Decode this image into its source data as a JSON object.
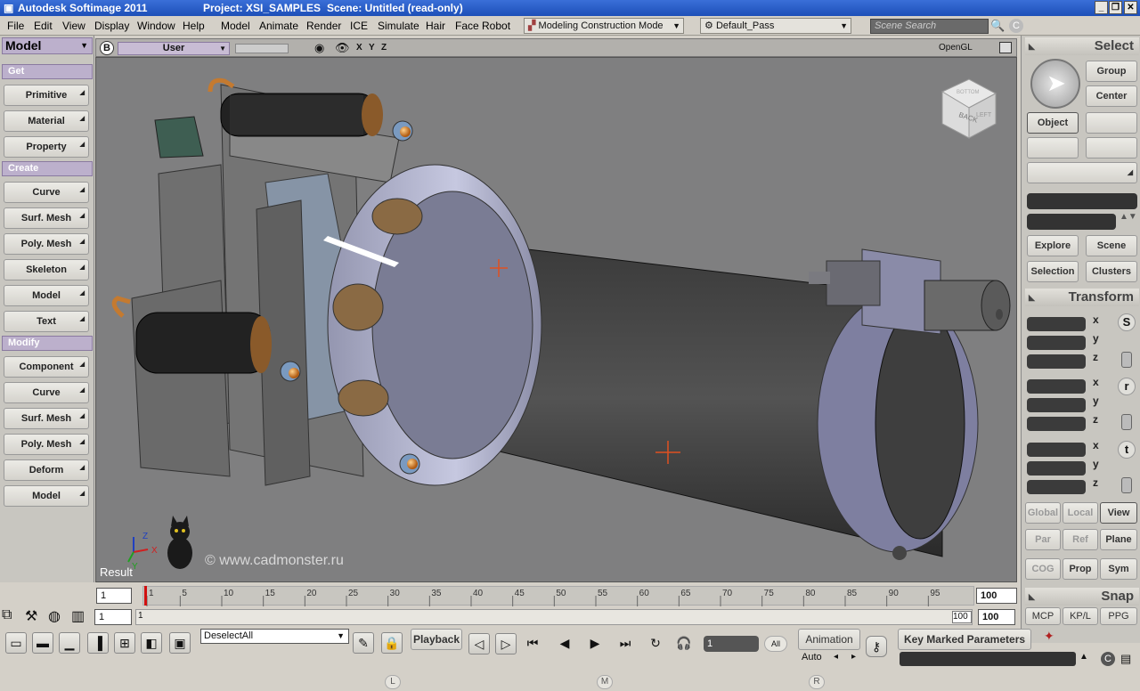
{
  "app": {
    "title": "Autodesk Softimage 2011",
    "project": "Project: XSI_SAMPLES",
    "scene": "Scene: Untitled (read-only)"
  },
  "menus": [
    "File",
    "Edit",
    "View",
    "Display",
    "Window",
    "Help",
    "Model",
    "Animate",
    "Render",
    "ICE",
    "Simulate",
    "Hair",
    "Face Robot"
  ],
  "mode_dropdown": "Modeling Construction Mode",
  "pass_dropdown": "Default_Pass",
  "search": {
    "placeholder": "Scene Search"
  },
  "left_panel": {
    "module": "Model",
    "get": {
      "header": "Get",
      "items": [
        "Primitive",
        "Material",
        "Property"
      ]
    },
    "create": {
      "header": "Create",
      "items": [
        "Curve",
        "Surf. Mesh",
        "Poly. Mesh",
        "Skeleton",
        "Model",
        "Text"
      ]
    },
    "modify": {
      "header": "Modify",
      "items": [
        "Component",
        "Curve",
        "Surf. Mesh",
        "Poly. Mesh",
        "Deform",
        "Model"
      ]
    }
  },
  "viewport": {
    "letter": "B",
    "camera": "User",
    "axes": [
      "X",
      "Y",
      "Z"
    ],
    "renderer": "OpenGL",
    "cube_labels": [
      "BACK",
      "LEFT",
      "BOTTOM"
    ],
    "axis_labels": [
      "Z",
      "X",
      "Y"
    ],
    "watermark": "© www.cadmonster.ru",
    "result": "Result"
  },
  "right_panel": {
    "select_header": "Select",
    "group": "Group",
    "center": "Center",
    "object": "Object",
    "explore": "Explore",
    "scene": "Scene",
    "selection": "Selection",
    "clusters": "Clusters",
    "transform_header": "Transform",
    "axes": [
      "x",
      "y",
      "z"
    ],
    "sections": [
      "S",
      "r",
      "t"
    ],
    "ref_buttons": [
      "Global",
      "Local",
      "View",
      "Par",
      "Ref",
      "Plane",
      "COG",
      "Prop",
      "Sym"
    ],
    "snap_header": "Snap",
    "tabs": [
      "MCP",
      "KP/L",
      "PPG"
    ]
  },
  "timeline": {
    "start": "1",
    "end": "100",
    "ticks": [
      "1",
      "5",
      "10",
      "15",
      "20",
      "25",
      "30",
      "35",
      "40",
      "45",
      "50",
      "55",
      "60",
      "65",
      "70",
      "75",
      "80",
      "85",
      "90",
      "95"
    ],
    "range_start": "1",
    "range_start_label": "1",
    "range_end_label": "100",
    "range_end": "100"
  },
  "bottom": {
    "deselect": "DeselectAll",
    "playback": "Playback",
    "frame": "1",
    "all": "All",
    "animation": "Animation",
    "auto": "Auto",
    "key_marked": "Key Marked Parameters",
    "pills": [
      "L",
      "M",
      "R"
    ]
  }
}
